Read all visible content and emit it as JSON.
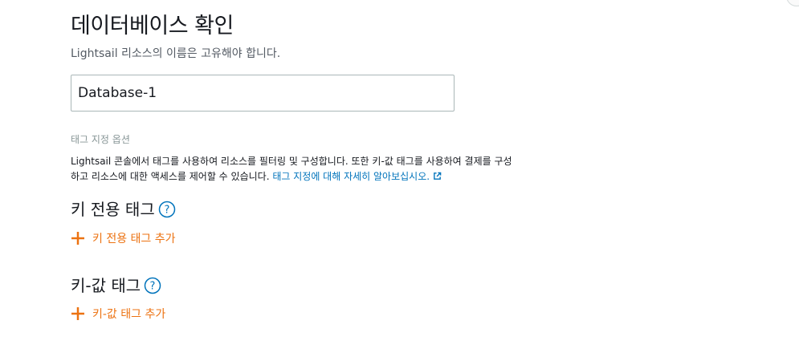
{
  "header": {
    "title": "데이터베이스 확인",
    "hint": "Lightsail 리소스의 이름은 고유해야 합니다."
  },
  "name_input": {
    "value": "Database-1"
  },
  "tags": {
    "caption": "태그 지정 옵션",
    "description_line1": "Lightsail 콘솔에서 태그를 사용하여 리소스를 필터링 및 구성합니다. 또한 키-값 태그를 사용하여 결제를 구성",
    "description_line2": "하고 리소스에 대한 액세스를 제어할 수 있습니다.",
    "learn_more_link": "태그 지정에 대해 자세히 알아보십시오."
  },
  "key_only_tags": {
    "title": "키 전용 태그",
    "add_label": "키 전용 태그 추가"
  },
  "key_value_tags": {
    "title": "키-값 태그",
    "add_label": "키-값 태그 추가"
  },
  "colors": {
    "accent_orange": "#ec7211",
    "link_blue": "#0073bb",
    "help_blue": "#0073bb"
  },
  "icons": {
    "help": "help-circle-icon",
    "add": "plus-icon",
    "external": "external-link-icon"
  }
}
